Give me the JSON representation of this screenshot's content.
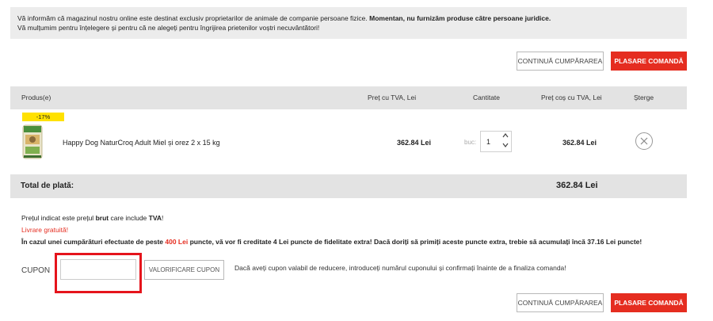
{
  "notice": {
    "line1_a": "Vă informăm că magazinul nostru online este destinat exclusiv proprietarilor de animale de companie persoane fizice. ",
    "line1_b": "Momentan, nu furnizăm produse către persoane juridice",
    "line1_c": ".",
    "line2": "Vă mulțumim pentru înțelegere și pentru că ne alegeți pentru îngrijirea prietenilor voștri necuvântători!"
  },
  "buttons": {
    "continue": "CONTINUĂ CUMPĂRAREA",
    "order": "PLASARE COMANDĂ"
  },
  "table": {
    "headers": {
      "product": "Produs(e)",
      "price": "Preț cu TVA, Lei",
      "quantity": "Cantitate",
      "cart_price": "Preț coș cu TVA, Lei",
      "delete": "Șterge"
    },
    "items": [
      {
        "discount": "-17%",
        "name": "Happy Dog NaturCroq Adult Miel și orez 2 x 15 kg",
        "price": "362.84 Lei",
        "unit": "buc",
        "quantity": "1",
        "total": "362.84 Lei",
        "remove_icon": "close-circle-icon"
      }
    ]
  },
  "total": {
    "label": "Total de plată:",
    "value": "362.84 Lei"
  },
  "info": {
    "l1_a": "Prețul indicat este prețul ",
    "l1_b": "brut",
    "l1_c": " care include ",
    "l1_d": "TVA",
    "l1_e": "!",
    "l2": "Livrare gratuită!",
    "l3_a": "În cazul unei cumpărături efectuate de peste ",
    "l3_b": "400 Lei",
    "l3_c": " puncte, vă vor fi creditate 4 Lei puncte de fidelitate extra! Dacă doriți să primiți aceste puncte extra, trebie să acumulați încă 37.16 Lei puncte!"
  },
  "coupon": {
    "label": "CUPON",
    "value": "",
    "button": "VALORIFICARE CUPON",
    "hint": "Dacă aveți cupon valabil de reducere, introduceți numărul cuponului și confirmați înainte de a finaliza comanda!"
  },
  "colors": {
    "accent": "#e52d20",
    "discount_badge": "#ffe100",
    "highlight": "#e5141c"
  }
}
